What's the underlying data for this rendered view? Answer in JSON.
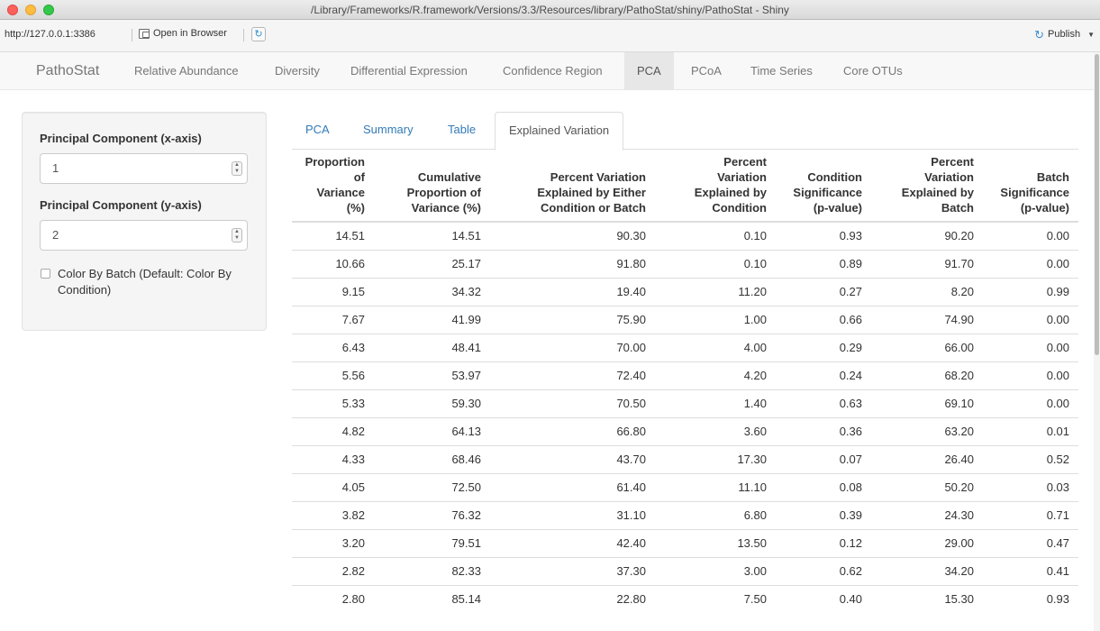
{
  "window": {
    "title": "/Library/Frameworks/R.framework/Versions/3.3/Resources/library/PathoStat/shiny/PathoStat - Shiny"
  },
  "toolbar": {
    "url": "http://127.0.0.1:3386",
    "open_browser_label": "Open in Browser",
    "publish_label": "Publish"
  },
  "navbar": {
    "brand": "PathoStat",
    "items": [
      {
        "label": "Relative Abundance"
      },
      {
        "label": "Diversity"
      },
      {
        "label": "Differential Expression"
      },
      {
        "label": "Confidence Region"
      },
      {
        "label": "PCA"
      },
      {
        "label": "PCoA"
      },
      {
        "label": "Time Series"
      },
      {
        "label": "Core OTUs"
      }
    ],
    "active": "PCA"
  },
  "sidebar": {
    "pc_x_label": "Principal Component (x-axis)",
    "pc_x_value": "1",
    "pc_y_label": "Principal Component (y-axis)",
    "pc_y_value": "2",
    "color_by_batch_label": "Color By Batch (Default: Color By Condition)",
    "color_by_batch_checked": false
  },
  "tabs": {
    "items": [
      {
        "label": "PCA"
      },
      {
        "label": "Summary"
      },
      {
        "label": "Table"
      },
      {
        "label": "Explained Variation"
      }
    ],
    "active": "Explained Variation"
  },
  "table": {
    "columns": [
      [
        "Proportion",
        "of",
        "Variance",
        "(%)"
      ],
      [
        "Cumulative",
        "Proportion of",
        "Variance (%)"
      ],
      [
        "Percent Variation",
        "Explained by Either",
        "Condition or Batch"
      ],
      [
        "Percent",
        "Variation",
        "Explained by",
        "Condition"
      ],
      [
        "Condition",
        "Significance",
        "(p-value)"
      ],
      [
        "Percent",
        "Variation",
        "Explained by",
        "Batch"
      ],
      [
        "Batch",
        "Significance",
        "(p-value)"
      ]
    ],
    "rows": [
      [
        "14.51",
        "14.51",
        "90.30",
        "0.10",
        "0.93",
        "90.20",
        "0.00"
      ],
      [
        "10.66",
        "25.17",
        "91.80",
        "0.10",
        "0.89",
        "91.70",
        "0.00"
      ],
      [
        "9.15",
        "34.32",
        "19.40",
        "11.20",
        "0.27",
        "8.20",
        "0.99"
      ],
      [
        "7.67",
        "41.99",
        "75.90",
        "1.00",
        "0.66",
        "74.90",
        "0.00"
      ],
      [
        "6.43",
        "48.41",
        "70.00",
        "4.00",
        "0.29",
        "66.00",
        "0.00"
      ],
      [
        "5.56",
        "53.97",
        "72.40",
        "4.20",
        "0.24",
        "68.20",
        "0.00"
      ],
      [
        "5.33",
        "59.30",
        "70.50",
        "1.40",
        "0.63",
        "69.10",
        "0.00"
      ],
      [
        "4.82",
        "64.13",
        "66.80",
        "3.60",
        "0.36",
        "63.20",
        "0.01"
      ],
      [
        "4.33",
        "68.46",
        "43.70",
        "17.30",
        "0.07",
        "26.40",
        "0.52"
      ],
      [
        "4.05",
        "72.50",
        "61.40",
        "11.10",
        "0.08",
        "50.20",
        "0.03"
      ],
      [
        "3.82",
        "76.32",
        "31.10",
        "6.80",
        "0.39",
        "24.30",
        "0.71"
      ],
      [
        "3.20",
        "79.51",
        "42.40",
        "13.50",
        "0.12",
        "29.00",
        "0.47"
      ],
      [
        "2.82",
        "82.33",
        "37.30",
        "3.00",
        "0.62",
        "34.20",
        "0.41"
      ],
      [
        "2.80",
        "85.14",
        "22.80",
        "7.50",
        "0.40",
        "15.30",
        "0.93"
      ]
    ]
  },
  "colors": {
    "link": "#337ab7",
    "navbar_bg": "#f8f8f8",
    "nav_active_bg": "#e7e7e7",
    "sidebar_bg": "#f5f5f5"
  }
}
